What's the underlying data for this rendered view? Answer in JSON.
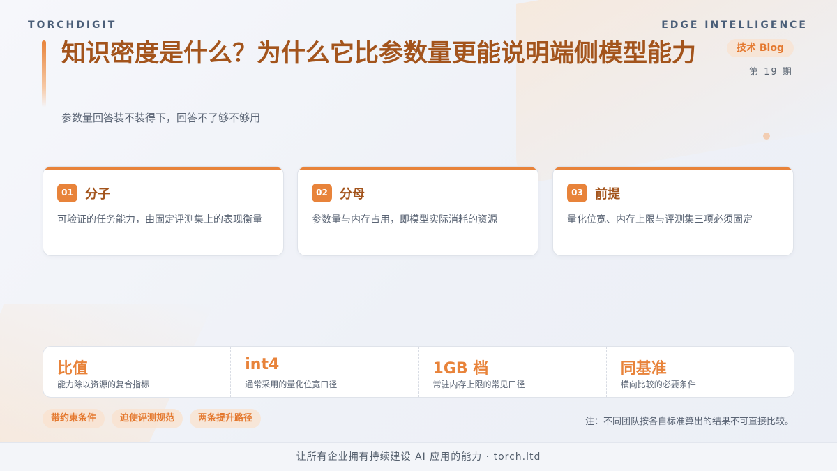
{
  "brand": {
    "left": "TORCHDIGIT",
    "right": "EDGE INTELLIGENCE"
  },
  "header": {
    "title": "知识密度是什么？为什么它比参数量更能说明端侧模型能力",
    "subtitle": "参数量回答装不装得下，回答不了够不够用",
    "tag": "技术 Blog",
    "issue": "第 19 期"
  },
  "cards": [
    {
      "num": "01",
      "title": "分子",
      "desc": "可验证的任务能力，由固定评测集上的表现衡量"
    },
    {
      "num": "02",
      "title": "分母",
      "desc": "参数量与内存占用，即模型实际消耗的资源"
    },
    {
      "num": "03",
      "title": "前提",
      "desc": "量化位宽、内存上限与评测集三项必须固定"
    }
  ],
  "stats": [
    {
      "value": "比值",
      "label": "能力除以资源的复合指标"
    },
    {
      "value": "int4",
      "label": "通常采用的量化位宽口径"
    },
    {
      "value": "1GB 档",
      "label": "常驻内存上限的常见口径"
    },
    {
      "value": "同基准",
      "label": "横向比较的必要条件"
    }
  ],
  "pills": [
    "带约束条件",
    "迫使评测规范",
    "两条提升路径"
  ],
  "note": "注：不同团队按各自标准算出的结果不可直接比较。",
  "footer": "让所有企业拥有持续建设 AI 应用的能力 · torch.ltd",
  "colors": {
    "accent": "#e8833a",
    "title": "#a3541c"
  }
}
